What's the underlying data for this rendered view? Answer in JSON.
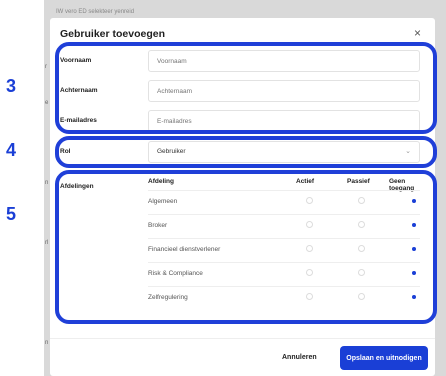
{
  "background": {
    "top_text": "IW vero ED selekteer yenreid",
    "left_marks": [
      "",
      "r",
      "e",
      "n",
      "rl",
      "n"
    ]
  },
  "modal": {
    "title": "Gebruiker toevoegen",
    "close_symbol": "×"
  },
  "fields": {
    "voornaam": {
      "label": "Voornaam",
      "placeholder": "Voornaam",
      "value": ""
    },
    "achternaam": {
      "label": "Achternaam",
      "placeholder": "Achternaam",
      "value": ""
    },
    "email": {
      "label": "E-mailadres",
      "placeholder": "E-mailadres",
      "value": ""
    },
    "rol": {
      "label": "Rol",
      "selected": "Gebruiker"
    }
  },
  "departments": {
    "section_label": "Afdelingen",
    "headers": [
      "Afdeling",
      "Actief",
      "Passief",
      "Geen toegang"
    ],
    "rows": [
      {
        "name": "Algemeen",
        "selected": "Geen toegang"
      },
      {
        "name": "Broker",
        "selected": "Geen toegang"
      },
      {
        "name": "Financieel dienstverlener",
        "selected": "Geen toegang"
      },
      {
        "name": "Risk & Compliance",
        "selected": "Geen toegang"
      },
      {
        "name": "Zelfregulering",
        "selected": "Geen toegang"
      }
    ]
  },
  "footer": {
    "cancel_label": "Annuleren",
    "save_label": "Opslaan en uitnodigen"
  },
  "annotations": [
    "3",
    "4",
    "5"
  ],
  "colors": {
    "accent": "#1a3fd6"
  }
}
